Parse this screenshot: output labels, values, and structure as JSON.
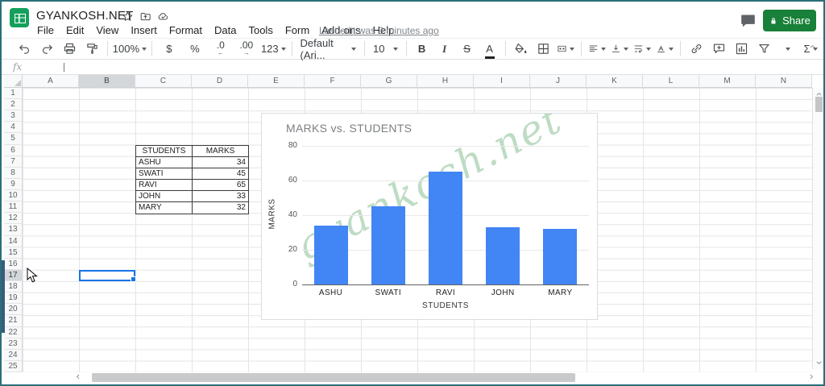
{
  "titlebar": {
    "doc_title": "GYANKOSH.NET",
    "share_label": "Share"
  },
  "menus": [
    "File",
    "Edit",
    "View",
    "Insert",
    "Format",
    "Data",
    "Tools",
    "Form",
    "Add-ons",
    "Help"
  ],
  "last_edit": "Last edit was 3 minutes ago",
  "toolbar": {
    "zoom": "100%",
    "currency": "$",
    "percent": "%",
    "decimal_decrease": ".0",
    "decimal_increase": ".00",
    "more_formats": "123",
    "font_name": "Default (Ari...",
    "font_size": "10",
    "bold": "B",
    "italic": "I",
    "strikethrough": "S",
    "text_color": "A",
    "functions": "Σ"
  },
  "formula_bar": {
    "label": "fx",
    "value": ""
  },
  "grid": {
    "columns": [
      "A",
      "B",
      "C",
      "D",
      "E",
      "F",
      "G",
      "H",
      "I",
      "J",
      "K",
      "L",
      "M",
      "N"
    ],
    "rows": [
      "1",
      "2",
      "3",
      "4",
      "5",
      "6",
      "7",
      "8",
      "9",
      "10",
      "11",
      "12",
      "13",
      "14",
      "15",
      "16",
      "17",
      "18",
      "19",
      "20",
      "21",
      "22",
      "23",
      "24",
      "25"
    ],
    "selected_cell": "B17",
    "selected_column": "B",
    "selected_row": "17"
  },
  "table": {
    "headers": [
      "STUDENTS",
      "MARKS"
    ],
    "rows": [
      [
        "ASHU",
        "34"
      ],
      [
        "SWATI",
        "45"
      ],
      [
        "RAVI",
        "65"
      ],
      [
        "JOHN",
        "33"
      ],
      [
        "MARY",
        "32"
      ]
    ]
  },
  "chart_data": {
    "type": "bar",
    "title": "MARKS vs. STUDENTS",
    "categories": [
      "ASHU",
      "SWATI",
      "RAVI",
      "JOHN",
      "MARY"
    ],
    "values": [
      34,
      45,
      65,
      33,
      32
    ],
    "xlabel": "STUDENTS",
    "ylabel": "MARKS",
    "ylim": [
      0,
      80
    ],
    "yticks": [
      0,
      20,
      40,
      60,
      80
    ],
    "grid": true,
    "legend": "none",
    "bar_color": "#4285f4",
    "watermark": "gyankosh.net"
  },
  "colors": {
    "accent_green": "#188038",
    "selection_blue": "#1a73e8",
    "bar_blue": "#4285f4"
  }
}
